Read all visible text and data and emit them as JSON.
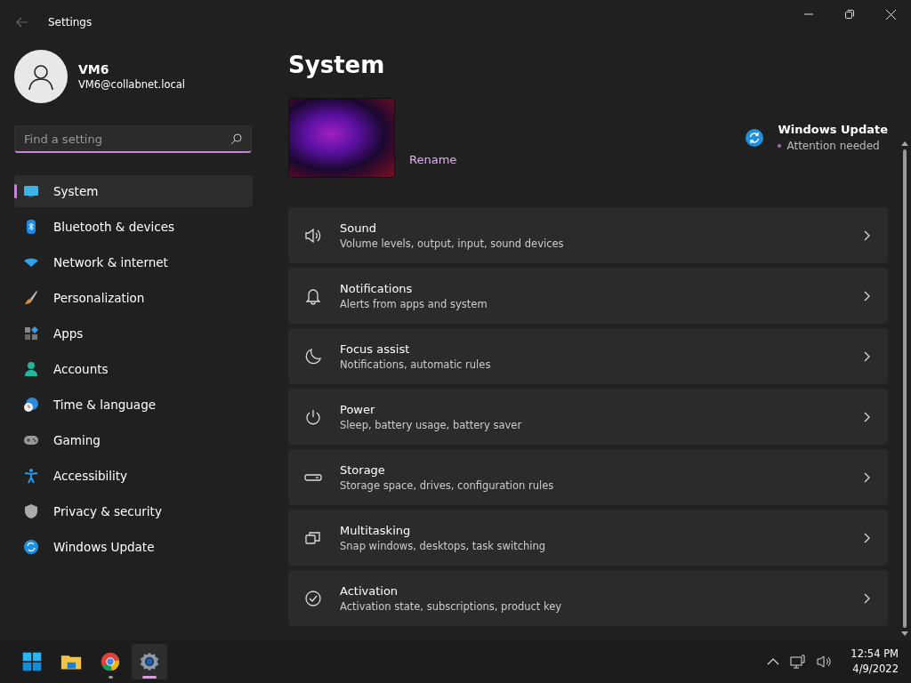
{
  "window": {
    "title": "Settings"
  },
  "profile": {
    "name": "VM6",
    "email": "VM6@collabnet.local"
  },
  "search": {
    "placeholder": "Find a setting"
  },
  "sidebar": {
    "items": [
      {
        "label": "System",
        "kind": "system",
        "selected": true
      },
      {
        "label": "Bluetooth & devices",
        "kind": "bluetooth",
        "selected": false
      },
      {
        "label": "Network & internet",
        "kind": "network",
        "selected": false
      },
      {
        "label": "Personalization",
        "kind": "brush",
        "selected": false
      },
      {
        "label": "Apps",
        "kind": "apps",
        "selected": false
      },
      {
        "label": "Accounts",
        "kind": "accounts",
        "selected": false
      },
      {
        "label": "Time & language",
        "kind": "time",
        "selected": false
      },
      {
        "label": "Gaming",
        "kind": "gaming",
        "selected": false
      },
      {
        "label": "Accessibility",
        "kind": "accessibility",
        "selected": false
      },
      {
        "label": "Privacy & security",
        "kind": "privacy",
        "selected": false
      },
      {
        "label": "Windows Update",
        "kind": "update",
        "selected": false
      }
    ]
  },
  "page": {
    "title": "System",
    "rename": "Rename",
    "update": {
      "title": "Windows Update",
      "status": "Attention needed"
    }
  },
  "settings": [
    {
      "kind": "sound",
      "title": "Sound",
      "subtitle": "Volume levels, output, input, sound devices"
    },
    {
      "kind": "notifications",
      "title": "Notifications",
      "subtitle": "Alerts from apps and system"
    },
    {
      "kind": "focus",
      "title": "Focus assist",
      "subtitle": "Notifications, automatic rules"
    },
    {
      "kind": "power",
      "title": "Power",
      "subtitle": "Sleep, battery usage, battery saver"
    },
    {
      "kind": "storage",
      "title": "Storage",
      "subtitle": "Storage space, drives, configuration rules"
    },
    {
      "kind": "multitasking",
      "title": "Multitasking",
      "subtitle": "Snap windows, desktops, task switching"
    },
    {
      "kind": "activation",
      "title": "Activation",
      "subtitle": "Activation state, subscriptions, product key"
    }
  ],
  "taskbar": {
    "apps": [
      {
        "kind": "start",
        "running": false,
        "active": false
      },
      {
        "kind": "explorer",
        "running": false,
        "active": false
      },
      {
        "kind": "browser",
        "running": true,
        "active": false
      },
      {
        "kind": "settings",
        "running": true,
        "active": true
      }
    ],
    "time": "12:54 PM",
    "date": "4/9/2022"
  }
}
